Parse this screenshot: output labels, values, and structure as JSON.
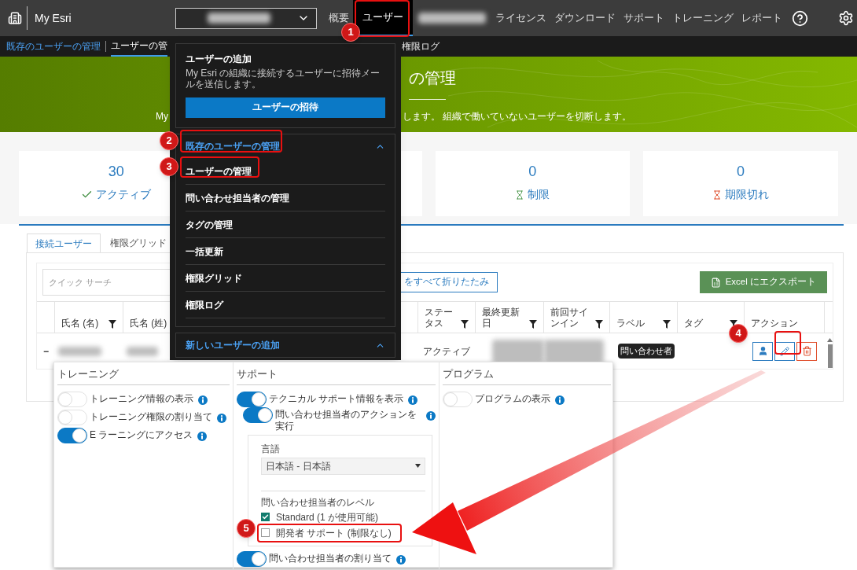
{
  "top_bar": {
    "app_name": "My Esri",
    "nav": [
      {
        "kind": "link",
        "label": "概要",
        "selected": false
      },
      {
        "kind": "link",
        "label": "ユーザー",
        "selected": true
      },
      {
        "kind": "redacted"
      },
      {
        "kind": "link",
        "label": "ライセンス",
        "selected": false
      },
      {
        "kind": "link",
        "label": "ダウンロード",
        "selected": false
      },
      {
        "kind": "link",
        "label": "サポート",
        "selected": false
      },
      {
        "kind": "link",
        "label": "トレーニング",
        "selected": false
      },
      {
        "kind": "link",
        "label": "レポート",
        "selected": false
      }
    ]
  },
  "sub_nav": {
    "section": "既存のユーザーの管理",
    "items": [
      {
        "label": "ユーザーの管",
        "selected": true
      },
      {
        "label": "権限ログ",
        "selected": false
      }
    ]
  },
  "banner": {
    "title": "の管理",
    "description_left": "My",
    "description_right": "します。 組織で働いていないユーザーを切断します。"
  },
  "stats": [
    {
      "kind": "active",
      "count": "30",
      "label": "アクティブ"
    },
    {
      "kind": "blank"
    },
    {
      "kind": "limited",
      "count": "0",
      "label": "制限"
    },
    {
      "kind": "expired",
      "count": "0",
      "label": "期限切れ"
    }
  ],
  "table": {
    "tabs": [
      {
        "label": "接続ユーザー",
        "selected": true
      },
      {
        "label": "権限グリッド",
        "selected": false
      }
    ],
    "search": {
      "placeholder": "クイック サーチ"
    },
    "collapse_button": "をすべて折りたたみ",
    "export_button": "Excel にエクスポート",
    "columns": [
      {
        "label": "氏名 (名)",
        "filter": true
      },
      {
        "label": "氏名 (姓)",
        "filter": false
      },
      {
        "label": "ステータス",
        "filter": true
      },
      {
        "label": "最終更新日",
        "filter": true
      },
      {
        "label": "前回サインイン",
        "filter": true
      },
      {
        "label": "ラベル",
        "filter": true
      },
      {
        "label": "タグ",
        "filter": true
      },
      {
        "label": "アクション",
        "filter": false
      }
    ],
    "rows": [
      {
        "expander": "−",
        "status": "アクティブ",
        "label": "問い合わせ者"
      }
    ]
  },
  "user_menu": {
    "add_section": {
      "title": "ユーザーの追加",
      "description": "My Esri の組織に接続するユーザーに招待メールを送信します。",
      "button": "ユーザーの招待"
    },
    "groups": [
      {
        "title": "既存のユーザーの管理",
        "expanded": true,
        "items": [
          "ユーザーの管理",
          "問い合わせ担当者の管理",
          "タグの管理",
          "一括更新",
          "権限グリッド",
          "権限ログ"
        ]
      },
      {
        "title": "新しいユーザーの追加",
        "expanded": true
      }
    ]
  },
  "settings_panel": {
    "sections": [
      {
        "title": "トレーニング",
        "items": [
          {
            "kind": "toggle",
            "label": "トレーニング情報の表示",
            "on": false
          },
          {
            "kind": "toggle",
            "label": "トレーニング権限の割り当て",
            "on": false
          },
          {
            "kind": "toggle",
            "label": "E ラーニングにアクセス",
            "on": true
          }
        ]
      },
      {
        "title": "サポート",
        "items": [
          {
            "kind": "toggle",
            "label": "テクニカル サポート情報を表示",
            "on": true,
            "children": [
              {
                "kind": "toggle",
                "label": "問い合わせ担当者のアクションを実行",
                "on": true
              }
            ]
          },
          {
            "kind": "settings_box",
            "language_label": "言語",
            "language_value": "日本語 - 日本語",
            "level_label": "問い合わせ担当者のレベル",
            "levels": [
              {
                "label": "Standard (1 が使用可能)",
                "checked": true
              },
              {
                "label": "開発者 サポート (制限なし)",
                "checked": false
              }
            ]
          },
          {
            "kind": "toggle",
            "label": "問い合わせ担当者の割り当て",
            "on": true
          }
        ]
      },
      {
        "title": "プログラム",
        "items": [
          {
            "kind": "toggle",
            "label": "プログラムの表示",
            "on": false
          }
        ]
      }
    ]
  },
  "annotations": [
    {
      "number": "1"
    },
    {
      "number": "2"
    },
    {
      "number": "3"
    },
    {
      "number": "4"
    },
    {
      "number": "5"
    }
  ]
}
